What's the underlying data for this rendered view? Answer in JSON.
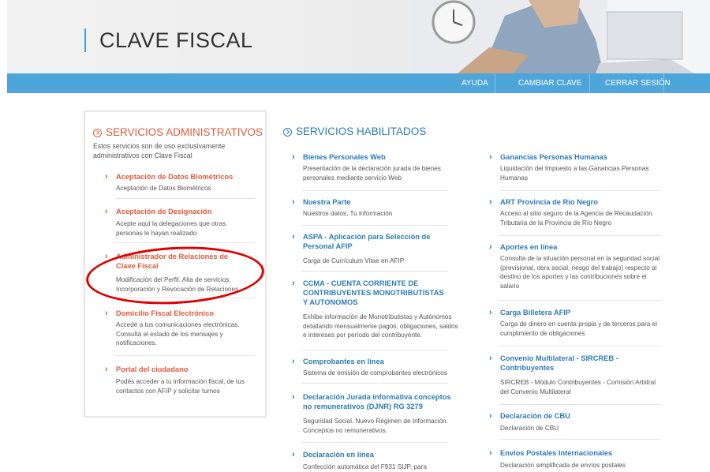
{
  "header": {
    "title": "CLAVE FISCAL"
  },
  "nav": {
    "items": [
      "AYUDA",
      "CAMBIAR CLAVE",
      "CERRAR SESIÓN"
    ]
  },
  "colors": {
    "nav_bar": "#4da5d9",
    "admin_accent": "#e05a3a",
    "habilitados_accent": "#2b7bb9",
    "highlight_circle": "#e00000"
  },
  "admin": {
    "heading": "SERVICIOS ADMINISTRATIVOS",
    "intro": "Estos servicios son de uso exclusivamente administrativos con Clave Fiscal",
    "items": [
      {
        "title": "Aceptación de Datos Biométricos",
        "desc": "Aceptación de Datos Biométricos"
      },
      {
        "title": "Aceptación de Designación",
        "desc": "Acepte aquí la delegaciones que otras personas le hayan realizado"
      },
      {
        "title": "Administrador de Relaciones de Clave Fiscal",
        "desc": "Modificación del Perfil. Alta de servicios. Incorporación y Revocación de Relaciones"
      },
      {
        "title": "Domicilio Fiscal Electrónico",
        "desc": "Accedé a tus comunicaciones electrónicas. Consultá el estado de los mensajes y notificaciones."
      },
      {
        "title": "Portal del ciudadano",
        "desc": "Podés acceder a tu información fiscal, de tus contactos con AFIP y solicitar turnos"
      }
    ]
  },
  "habilitados": {
    "heading": "SERVICIOS HABILITADOS",
    "col1": [
      {
        "title": "Bienes Personales Web",
        "desc": "Presentación de la declaración jurada de bienes personales mediante servicio Web"
      },
      {
        "title": "Nuestra Parte",
        "desc": "Nuestros datos, Tu información"
      },
      {
        "title": "ASPA - Aplicación para Selección de Personal AFIP",
        "desc": "Carga de Currículum Vitae en AFIP"
      },
      {
        "title": "CCMA - CUENTA CORRIENTE DE CONTRIBUYENTES MONOTRIBUTISTAS Y AUTONOMOS",
        "desc": "Exhibe información de Monotributistas y Autónomos detallando mensualmente pagos, obligaciones, saldos e intereses por período del contribuyente."
      },
      {
        "title": "Comprobantes en línea",
        "desc": "Sistema de emisión de comprobantes electrónicos"
      },
      {
        "title": "Declaración Jurada informativa conceptos no remunerativos (DJNR) RG 3279",
        "desc": "Seguridad Social. Nuevo Régimen de Información. Conceptos no remunerativos."
      },
      {
        "title": "Declaración en línea",
        "desc": "Confección automática del F931 SIJP, para"
      }
    ],
    "col2": [
      {
        "title": "Ganancias Personas Humanas",
        "desc": "Liquidación del Impuesto a las Ganancias Personas Humanas"
      },
      {
        "title": "ART Provincia de Río Negro",
        "desc": "Acceso al sitio seguro de la Agencia de Recaudación Tributaria de la Provincia de Río Negro"
      },
      {
        "title": "Aportes en línea",
        "desc": "Consulta de la situación personal en la seguridad social (previsional, obra social, riesgo del trabajo) respecto al destino de los aportes y las contribuciones sobre el salario"
      },
      {
        "title": "Carga Billetera AFIP",
        "desc": "Carga de dinero en cuenta propia y de terceros para el cumplimiento de obligaciones"
      },
      {
        "title": "Convenio Multilateral - SIRCREB - Contribuyentes",
        "desc": "SIRCREB - Módulo Contribuyentes - Comisión Arbitral del Convenio Multilateral"
      },
      {
        "title": "Declaración de CBU",
        "desc": "Declaración de CBU"
      },
      {
        "title": "Envíos Postales Internacionales",
        "desc": "Declaración simplificada de envíos postales"
      }
    ]
  }
}
